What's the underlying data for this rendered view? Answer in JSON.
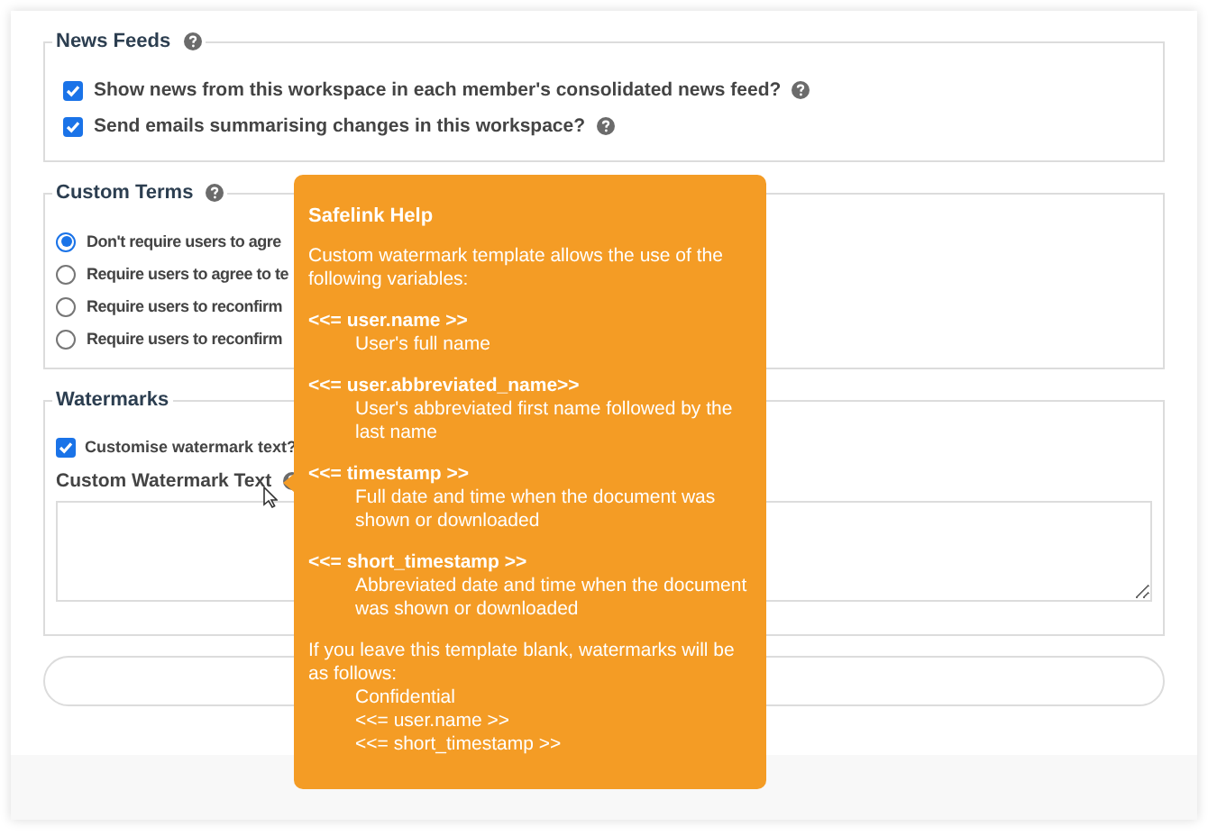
{
  "news_feeds": {
    "legend": "News Feeds",
    "options": [
      {
        "label": "Show news from this workspace in each member's consolidated news feed?",
        "checked": true
      },
      {
        "label": "Send emails summarising changes in this workspace?",
        "checked": true
      }
    ]
  },
  "custom_terms": {
    "legend": "Custom Terms",
    "options": [
      {
        "label": "Don't require users to agre",
        "selected": true
      },
      {
        "label": "Require users to agree to te",
        "selected": false
      },
      {
        "label": "Require users to reconfirm",
        "selected": false
      },
      {
        "label": "Require users to reconfirm",
        "selected": false
      }
    ]
  },
  "watermarks": {
    "legend": "Watermarks",
    "customise": {
      "label": "Customise watermark text?",
      "checked": true
    },
    "field_label": "Custom Watermark Text"
  },
  "tooltip": {
    "title": "Safelink Help",
    "intro": "Custom watermark template allows the use of the following variables:",
    "variables": [
      {
        "name": "<<= user.name >>",
        "description": "User's full name"
      },
      {
        "name": "<<= user.abbreviated_name>>",
        "description": "User's abbreviated first name followed by the last name"
      },
      {
        "name": "<<= timestamp >>",
        "description": "Full date and time when the document was shown or downloaded"
      },
      {
        "name": "<<= short_timestamp >>",
        "description": "Abbreviated date and time when the document was shown or downloaded"
      }
    ],
    "footer": "If you leave this template blank, watermarks will be as follows:",
    "defaults": [
      "Confidential",
      "<<= user.name >>",
      "<<= short_timestamp >>"
    ]
  }
}
